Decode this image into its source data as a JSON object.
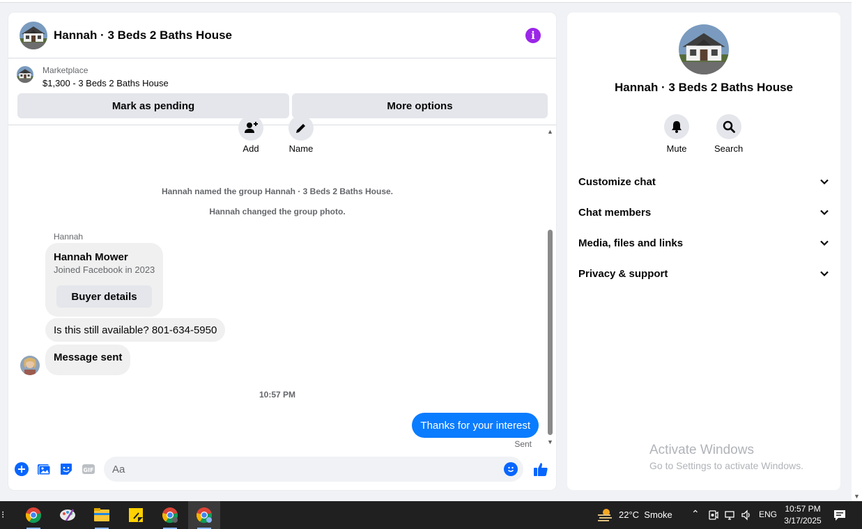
{
  "chat": {
    "title": "Hannah · 3 Beds 2 Baths House",
    "marketplace_label": "Marketplace",
    "listing": "$1,300 - 3 Beds 2 Baths House",
    "mark_pending": "Mark as pending",
    "more_options": "More options",
    "actions": {
      "add": "Add",
      "name": "Name"
    },
    "system_messages": [
      "Hannah named the group Hannah · 3 Beds 2 Baths House.",
      "Hannah changed the group photo."
    ],
    "sender_label": "Hannah",
    "buyer_card": {
      "name": "Hannah Mower",
      "joined": "Joined Facebook in 2023",
      "button": "Buyer details"
    },
    "incoming": [
      "Is this still available? 801-634-5950",
      "Message sent"
    ],
    "timestamp": "10:57 PM",
    "outgoing": "Thanks for your interest",
    "status": "Sent",
    "composer_placeholder": "Aa",
    "accent": "#0a7cff"
  },
  "info_panel": {
    "title": "Hannah · 3 Beds 2 Baths House",
    "mute": "Mute",
    "search": "Search",
    "sections": [
      "Customize chat",
      "Chat members",
      "Media, files and links",
      "Privacy & support"
    ]
  },
  "watermark": {
    "line1": "Activate Windows",
    "line2": "Go to Settings to activate Windows."
  },
  "taskbar": {
    "weather": "22°C  Smoke",
    "lang": "ENG",
    "time": "10:57 PM",
    "date": "3/17/2025",
    "apps": [
      "chrome-icon",
      "paint-icon",
      "file-explorer-icon",
      "sticky-notes-icon",
      "chrome-profile-icon",
      "chrome-active-icon"
    ]
  }
}
